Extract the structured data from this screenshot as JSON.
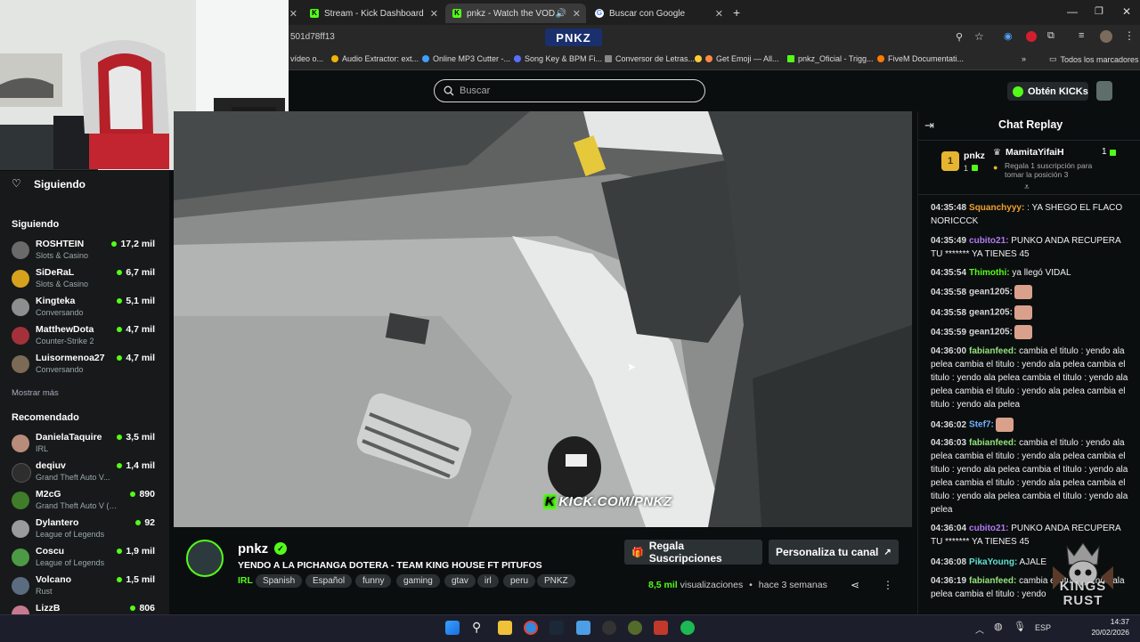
{
  "browser": {
    "tabs": [
      {
        "title": "Stream - Kick Dashboard",
        "favicon": "kick-icon"
      },
      {
        "title": "pnkz - Watch the VOD on K",
        "favicon": "kick-icon",
        "active": true
      },
      {
        "title": "Buscar con Google",
        "favicon": "google-icon"
      }
    ],
    "url_fragment": "501d78ff13",
    "site_logo": "PNKZ",
    "bookmarks": [
      "vídeo o...",
      "Audio Extractor: ext...",
      "Online MP3 Cutter -...",
      "Song Key & BPM Fi...",
      "Conversor de Letras...",
      "Get Emoji — All...",
      "pnkz_Oficial - Trigg...",
      "FiveM Documentati..."
    ],
    "all_bookmarks": "Todos los marcadores"
  },
  "topnav": {
    "search_placeholder": "Buscar",
    "kicks_label": "Obtén KICKs"
  },
  "sidebar": {
    "following_title": "Siguiendo",
    "following_section": "Siguiendo",
    "following": [
      {
        "name": "ROSHTEIN",
        "game": "Slots & Casino",
        "viewers": "17,2 mil",
        "color": "#6a6a6a"
      },
      {
        "name": "SiDeRaL",
        "game": "Slots & Casino",
        "viewers": "6,7 mil",
        "color": "#d6a21e"
      },
      {
        "name": "Kingteka",
        "game": "Conversando",
        "viewers": "5,1 mil",
        "color": "#8b8f8e"
      },
      {
        "name": "MatthewDota",
        "game": "Counter-Strike 2",
        "viewers": "4,7 mil",
        "color": "#a3313a"
      },
      {
        "name": "Luisormenoa27",
        "game": "Conversando",
        "viewers": "4,7 mil",
        "color": "#7b6a55"
      }
    ],
    "show_more": "Mostrar más",
    "recommended_section": "Recomendado",
    "recommended": [
      {
        "name": "DanielaTaquire",
        "game": "IRL",
        "viewers": "3,5 mil",
        "color": "#b78c7a"
      },
      {
        "name": "deqiuv",
        "game": "Grand Theft Auto V...",
        "viewers": "1,4 mil",
        "color": "#2e2e2e"
      },
      {
        "name": "M2cG",
        "game": "Grand Theft Auto V (G...",
        "viewers": "890",
        "color": "#3f7d2a"
      },
      {
        "name": "Dylantero",
        "game": "League of Legends",
        "viewers": "92",
        "color": "#9b9b9b"
      },
      {
        "name": "Coscu",
        "game": "League of Legends",
        "viewers": "1,9 mil",
        "color": "#4c9a45"
      },
      {
        "name": "Volcano",
        "game": "Rust",
        "viewers": "1,5 mil",
        "color": "#5b6c80"
      },
      {
        "name": "LizzB",
        "game": "",
        "viewers": "806",
        "color": "#c77a8f"
      }
    ]
  },
  "video": {
    "overlay_text": "KICK.COM/PNKZ"
  },
  "stream_info": {
    "channel": "pnkz",
    "title": "YENDO A LA PICHANGA DOTERA - TEAM KING HOUSE FT PITUFOS",
    "category": "IRL",
    "tags": [
      "Spanish",
      "Español",
      "funny",
      "gaming",
      "gtav",
      "irl",
      "peru",
      "PNKZ"
    ],
    "gift_button": "Regala Suscripciones",
    "customize_button": "Personaliza tu canal",
    "views": "8,5 mil",
    "views_label": "visualizaciones",
    "separator": "•",
    "ago": "hace 3 semanas"
  },
  "chat": {
    "title": "Chat Replay",
    "leaderboard": {
      "rank": "1",
      "user": "pnkz",
      "count": "1",
      "gifter": "MamitaYifaiH",
      "gifter_count": "1",
      "hint": "Regala 1 suscripción para tomar la posición 3"
    },
    "messages": [
      {
        "time": "04:35:48",
        "user": "Squanchyyy:",
        "color": "#f0a030",
        "text": ": YA SHEGO EL FLACO NORICCCK"
      },
      {
        "time": "04:35:49",
        "user": "cubito21:",
        "color": "#b27bf0",
        "text": "PUNKO ANDA RECUPERA TU ******* YA TIENES 45"
      },
      {
        "time": "04:35:54",
        "user": "Thimothi:",
        "color": "#53fc18",
        "text": "ya llegó VIDAL"
      },
      {
        "time": "04:35:58",
        "user": "gean1205:",
        "color": "#d7d7d7",
        "text": "",
        "emote": true
      },
      {
        "time": "04:35:58",
        "user": "gean1205:",
        "color": "#d7d7d7",
        "text": "",
        "emote": true
      },
      {
        "time": "04:35:59",
        "user": "gean1205:",
        "color": "#d7d7d7",
        "text": "",
        "emote": true
      },
      {
        "time": "04:36:00",
        "user": "fabianfeed:",
        "color": "#93e37a",
        "text": "cambia el titulo : yendo ala pelea cambia el titulo : yendo ala pelea cambia el titulo : yendo ala pelea cambia el titulo : yendo ala pelea cambia el titulo : yendo ala pelea cambia el titulo : yendo ala pelea"
      },
      {
        "time": "04:36:02",
        "user": "Stef7:",
        "color": "#6fb2ff",
        "text": "",
        "emote": true
      },
      {
        "time": "04:36:03",
        "user": "fabianfeed:",
        "color": "#93e37a",
        "text": "cambia el titulo : yendo ala pelea cambia el titulo : yendo ala pelea cambia el titulo : yendo ala pelea cambia el titulo : yendo ala pelea cambia el titulo : yendo ala pelea cambia el titulo : yendo ala pelea cambia el titulo : yendo ala pelea"
      },
      {
        "time": "04:36:04",
        "user": "cubito21:",
        "color": "#b27bf0",
        "text": "PUNKO ANDA RECUPERA TU ******* YA TIENES 45"
      },
      {
        "time": "04:36:08",
        "user": "PikaYoung:",
        "color": "#5ee0d0",
        "text": "AJALE"
      },
      {
        "time": "04:36:19",
        "user": "fabianfeed:",
        "color": "#93e37a",
        "text": "cambia el titulo : yendo ala pelea cambia el titulo : yendo"
      }
    ]
  },
  "overlay_logo": {
    "line1": "KINGS",
    "line2": "RUST"
  },
  "taskbar": {
    "lang": "ESP",
    "time": "14:37",
    "date": "20/02/2026"
  },
  "colors": {
    "kick_green": "#53fc18",
    "bg": "#0b0e0f",
    "sidebar": "#18191b"
  }
}
